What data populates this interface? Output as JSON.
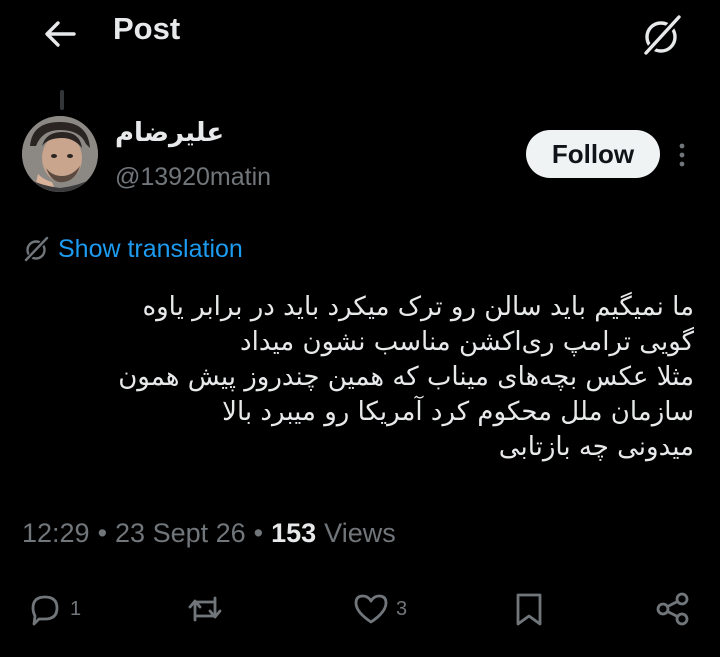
{
  "header": {
    "title": "Post"
  },
  "author": {
    "display_name": "علیرضام",
    "handle": "@13920matin",
    "follow_label": "Follow"
  },
  "translation": {
    "label": "Show translation"
  },
  "tweet": {
    "lines": [
      "ما نمیگیم باید سالن رو ترک میکرد باید در برابر یاوه",
      "گویی ترامپ ری‌اکشن مناسب نشون میداد",
      "مثلا عکس بچه‌های میناب که همین چندروز پیش همون",
      "سازمان ملل محکوم کرد آمریکا رو میبرد بالا",
      "میدونی چه بازتابی"
    ]
  },
  "meta": {
    "time": "12:29",
    "separator": "•",
    "date": "23 Sept 26",
    "views_count": "153",
    "views_label": "Views"
  },
  "actions": {
    "replies": "1",
    "reposts": "",
    "likes": "3"
  },
  "colors": {
    "background": "#000000",
    "text": "#e7e9ea",
    "secondary": "#71767b",
    "accent": "#1d9bf0",
    "follow_bg": "#eff3f4"
  },
  "icons": [
    "back-arrow-icon",
    "grok-icon",
    "more-icon",
    "translate-icon",
    "reply-icon",
    "repost-icon",
    "like-icon",
    "bookmark-icon",
    "share-icon"
  ]
}
